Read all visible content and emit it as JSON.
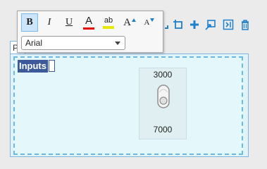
{
  "format_popup": {
    "bold_label": "B",
    "italic_label": "I",
    "underline_label": "U",
    "font_color_label": "A",
    "highlight_label": "ab",
    "grow_font_label": "A",
    "shrink_font_label": "A",
    "font_family": "Arial"
  },
  "page_tab": {
    "label": "P"
  },
  "canvas": {
    "selected_text": "Inputs",
    "switch": {
      "top_value": "3000",
      "bottom_value": "7000"
    }
  },
  "colors": {
    "accent": "#1e7fcb",
    "font_color_bar": "#e60000",
    "highlight_bar": "#e8e800",
    "selection": "#3c5a9a"
  }
}
